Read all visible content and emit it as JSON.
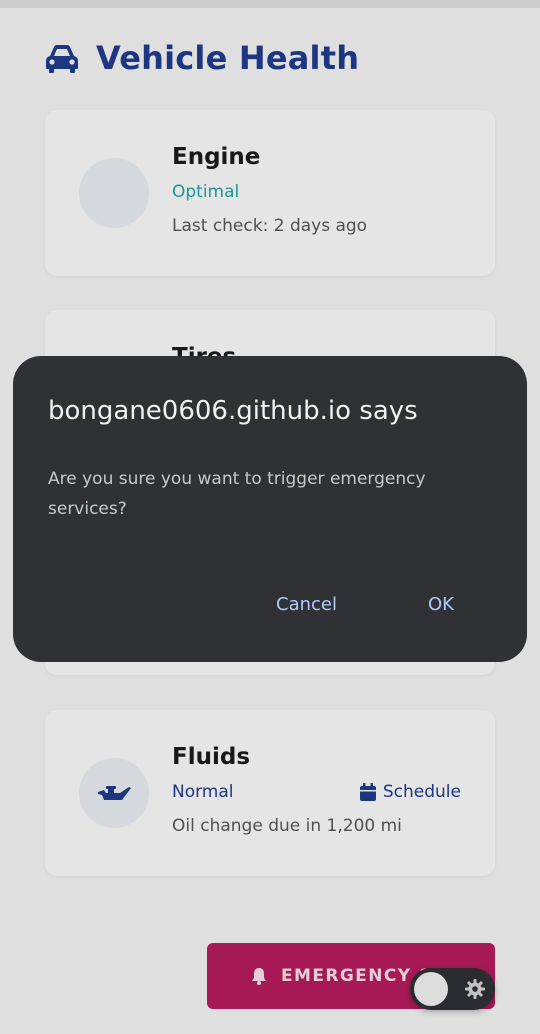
{
  "header": {
    "title": "Vehicle Health",
    "icon": "car-icon"
  },
  "cards": [
    {
      "title": "Engine",
      "status": "Optimal",
      "status_color": "#1aa3a0",
      "meta": "Last check: 2 days ago"
    },
    {
      "title": "Tires"
    },
    {
      "title": "Fluids",
      "status": "Normal",
      "status_color": "#1e3a8a",
      "action": "Schedule",
      "meta": "Oil change due in 1,200 mi",
      "icon": "oil-can-icon"
    }
  ],
  "emergency_button": {
    "label": "EMERGENCY S",
    "icon": "bell-icon"
  },
  "theme_toggle": {
    "icon": "gear-icon"
  },
  "dialog": {
    "title": "bongane0606.github.io says",
    "message": "Are you sure you want to trigger emergency services?",
    "cancel_label": "Cancel",
    "ok_label": "OK"
  }
}
